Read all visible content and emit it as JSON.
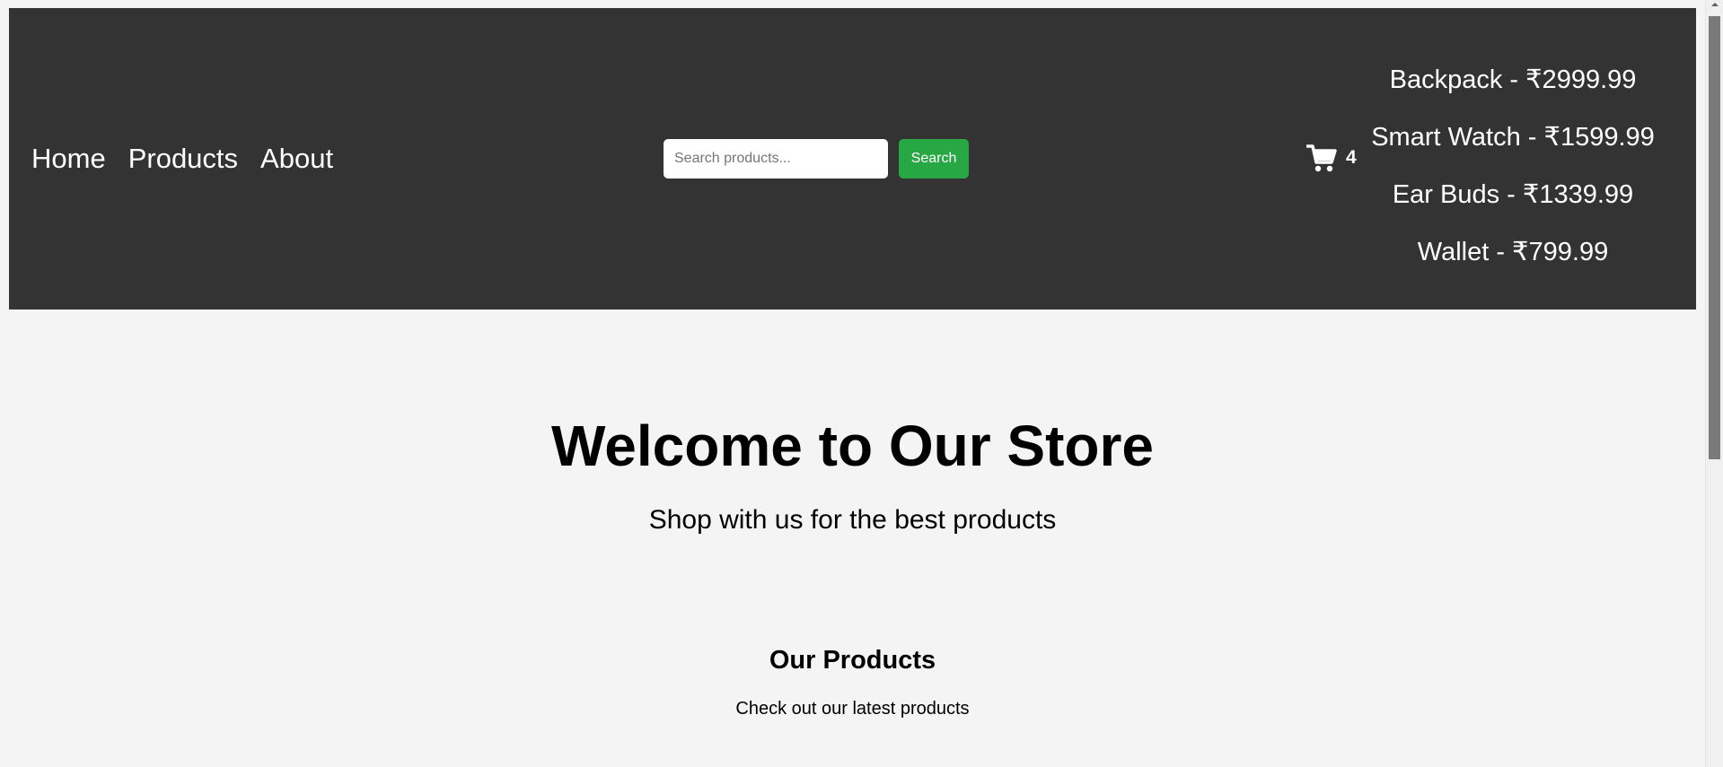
{
  "nav": {
    "items": [
      {
        "label": "Home"
      },
      {
        "label": "Products"
      },
      {
        "label": "About"
      }
    ]
  },
  "search": {
    "placeholder": "Search products...",
    "value": "",
    "button_label": "Search"
  },
  "cart": {
    "icon": "cart-icon",
    "count": "4",
    "items": [
      {
        "label": "Backpack - ₹2999.99"
      },
      {
        "label": "Smart Watch - ₹1599.99"
      },
      {
        "label": "Ear Buds - ₹1339.99"
      },
      {
        "label": "Wallet - ₹799.99"
      }
    ]
  },
  "hero": {
    "title": "Welcome to Our Store",
    "subtitle": "Shop with us for the best products"
  },
  "products_section": {
    "title": "Our Products",
    "subtitle": "Check out our latest products"
  },
  "colors": {
    "header_bg": "#333333",
    "page_bg": "#f4f4f4",
    "search_button": "#28a745",
    "text_light": "#ffffff"
  }
}
